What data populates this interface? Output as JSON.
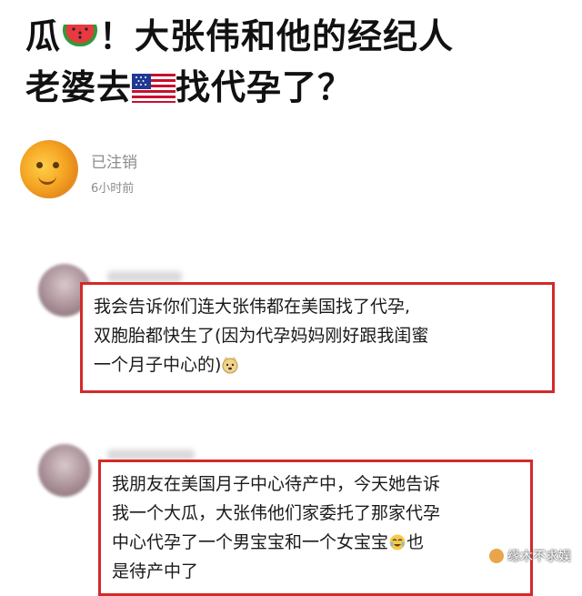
{
  "post": {
    "title_line1_a": "瓜",
    "title_line1_b": "！大张伟和他的经纪人",
    "title_line2_a": "老婆去",
    "title_line2_b": "找代孕了？",
    "emoji_watermelon": "watermelon-icon",
    "emoji_flag": "us-flag-icon"
  },
  "author": {
    "username": "已注销",
    "time": "6小时前"
  },
  "comments": [
    {
      "lines": [
        "我会告诉你们连大张伟都在美国找了代孕,",
        "双胞胎都快生了(因为代孕妈妈刚好跟我闺蜜",
        "一个月子中心的)"
      ],
      "emoji": "doge-face-icon"
    },
    {
      "lines": [
        "我朋友在美国月子中心待产中，今天她告诉",
        "我一个大瓜，大张伟他们家委托了那家代孕",
        "中心代孕了一个男宝宝和一个女宝宝",
        "是待产中了"
      ],
      "line3_suffix": "也",
      "emoji": "laughing-crying-icon"
    }
  ],
  "watermark": {
    "text": "缘木不求娱"
  },
  "colors": {
    "highlight_border": "#d32a2a",
    "meta_text": "#8c8c8c"
  }
}
